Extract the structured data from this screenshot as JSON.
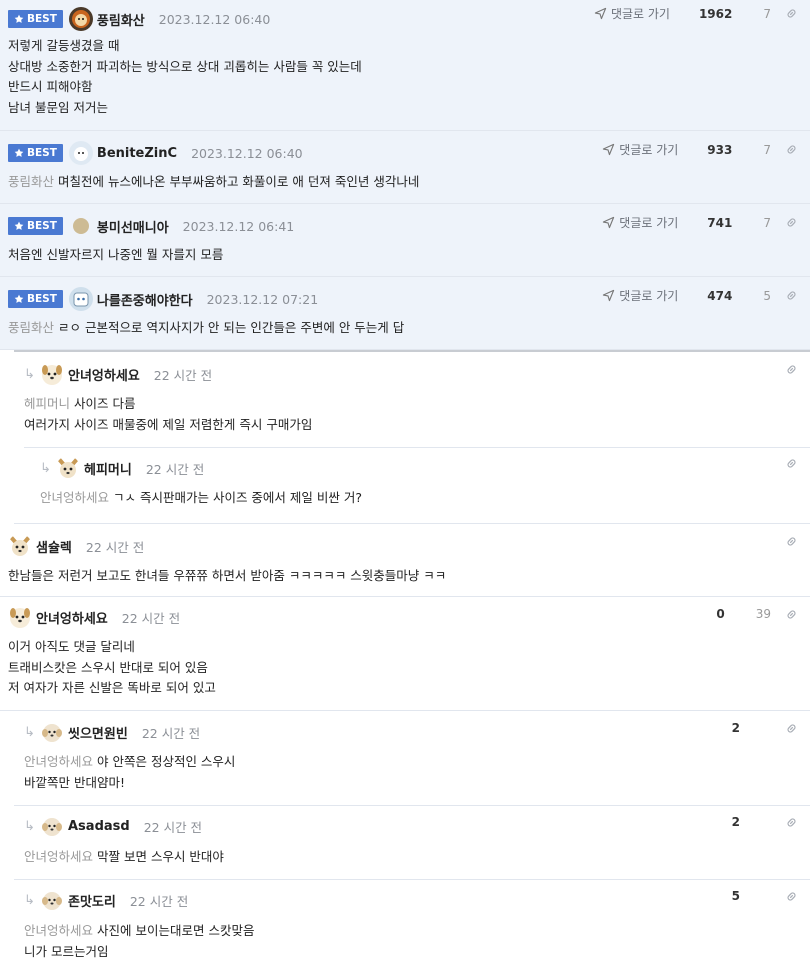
{
  "best_label": "BEST",
  "goto_label": "댓글로 가기",
  "comments": [
    {
      "nick": "풍림화산",
      "date": "2023.12.12 06:40",
      "up": "1962",
      "down": "7",
      "lines": [
        "저렇게 갈등생겼을 때",
        "상대방 소중한거 파괴하는 방식으로 상대 괴롭히는 사람들 꼭 있는데",
        "반드시 피해야함",
        "남녀 불문임 저거는"
      ]
    },
    {
      "nick": "BeniteZinC",
      "date": "2023.12.12 06:40",
      "up": "933",
      "down": "7",
      "mention": "풍림화산",
      "lines": [
        "며칠전에 뉴스에나온 부부싸움하고 화풀이로 애 던져 죽인년 생각나네"
      ]
    },
    {
      "nick": "봉미선매니아",
      "date": "2023.12.12 06:41",
      "up": "741",
      "down": "7",
      "lines": [
        "처음엔 신발자르지 나중엔 뭘 자를지 모름"
      ]
    },
    {
      "nick": "나를존중해야한다",
      "date": "2023.12.12 07:21",
      "up": "474",
      "down": "5",
      "mention": "풍림화산",
      "lines": [
        "ㄹㅇ 근본적으로 역지사지가 안 되는 인간들은 주변에 안 두는게 답"
      ]
    },
    {
      "nick": "안녀엉하세요",
      "date": "22 시간 전",
      "mention": "헤피머니",
      "lines": [
        "사이즈 다름",
        "여러가지 사이즈 매물중에 제일 저렴한게 즉시 구매가임"
      ]
    },
    {
      "nick": "헤피머니",
      "date": "22 시간 전",
      "mention": "안녀엉하세요",
      "lines": [
        "ㄱㅅ 즉시판매가는 사이즈 중에서 제일 비싼 거?"
      ]
    },
    {
      "nick": "샘슐렉",
      "date": "22 시간 전",
      "lines": [
        "한남들은 저런거 보고도 한녀들 우쮸쮸 하면서 받아줌 ㅋㅋㅋㅋㅋ 스윗충들마냥 ㅋㅋ"
      ]
    },
    {
      "nick": "안녀엉하세요",
      "date": "22 시간 전",
      "up": "0",
      "down": "39",
      "lines": [
        "이거 아직도 댓글 달리네",
        "트래비스캇은 스우시 반대로 되어 있음",
        "저 여자가 자른 신발은 똑바로 되어 있고"
      ]
    },
    {
      "nick": "씻으면원빈",
      "date": "22 시간 전",
      "up": "2",
      "mention": "안녀엉하세요",
      "lines": [
        "야 안쪽은 정상적인 스우시",
        "바깥쪽만 반대얌마!"
      ]
    },
    {
      "nick": "Asadasd",
      "date": "22 시간 전",
      "up": "2",
      "mention": "안녀엉하세요",
      "lines": [
        "막짤 보면 스우시 반대야"
      ]
    },
    {
      "nick": "존맛도리",
      "date": "22 시간 전",
      "up": "5",
      "mention": "안녀엉하세요",
      "lines": [
        "사진에 보이는대로면 스캇맞음",
        "니가 모르는거임"
      ]
    }
  ]
}
